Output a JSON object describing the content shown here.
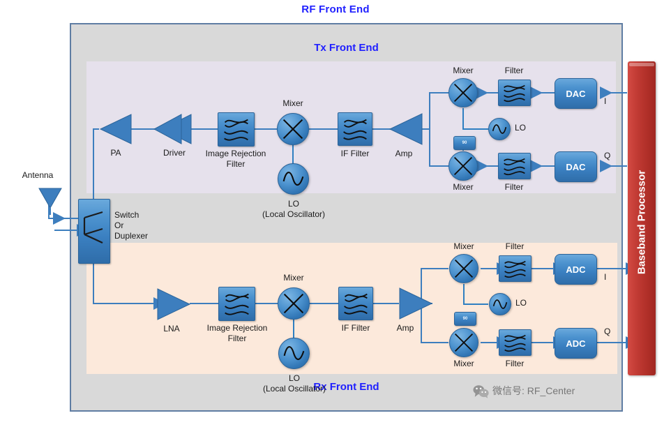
{
  "titles": {
    "rf_front_end": "RF Front End",
    "tx_front_end": "Tx Front End",
    "rx_front_end": "Rx Front End"
  },
  "baseband": {
    "label": "Baseband Processor",
    "color": "#b9302a"
  },
  "accent": {
    "title_blue": "#2020ff",
    "block_blue": "#3a7fc0",
    "tx_panel": "#e6e1ec",
    "rx_panel": "#fce9db",
    "frame_gray": "#d9d9d9",
    "wire_blue": "#3d7ebe"
  },
  "antenna": {
    "label": "Antenna"
  },
  "switch": {
    "label": "Switch\nOr\nDuplexer"
  },
  "tx_chain": {
    "pa": "PA",
    "driver": "Driver",
    "image_rejection_filter": "Image Rejection\nFilter",
    "mixer": "Mixer",
    "lo": "LO\n(Local Oscillator)",
    "if_filter": "IF Filter",
    "amp": "Amp",
    "iq": {
      "mixer_top": "Mixer",
      "mixer_bottom": "Mixer",
      "filter_top": "Filter",
      "filter_bottom": "Filter",
      "lo": "LO",
      "phase_shift": "90",
      "dac_top": "DAC",
      "dac_bottom": "DAC",
      "port_i": "I",
      "port_q": "Q"
    }
  },
  "rx_chain": {
    "lna": "LNA",
    "image_rejection_filter": "Image Rejection\nFilter",
    "mixer": "Mixer",
    "lo": "LO\n(Local Oscillator)",
    "if_filter": "IF Filter",
    "amp": "Amp",
    "iq": {
      "mixer_top": "Mixer",
      "mixer_bottom": "Mixer",
      "filter_top": "Filter",
      "filter_bottom": "Filter",
      "lo": "LO",
      "phase_shift": "90",
      "adc_top": "ADC",
      "adc_bottom": "ADC",
      "port_i": "I",
      "port_q": "Q"
    }
  },
  "watermark": {
    "text": "微信号: RF_Center"
  }
}
